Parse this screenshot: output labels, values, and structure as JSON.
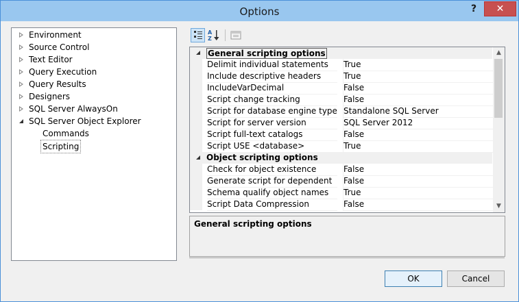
{
  "window": {
    "title": "Options",
    "help_label": "?",
    "close_label": "✕"
  },
  "tree": {
    "items": [
      {
        "label": "Environment",
        "state": "collapsed"
      },
      {
        "label": "Source Control",
        "state": "collapsed"
      },
      {
        "label": "Text Editor",
        "state": "collapsed"
      },
      {
        "label": "Query Execution",
        "state": "collapsed"
      },
      {
        "label": "Query Results",
        "state": "collapsed"
      },
      {
        "label": "Designers",
        "state": "collapsed"
      },
      {
        "label": "SQL Server AlwaysOn",
        "state": "collapsed"
      },
      {
        "label": "SQL Server Object Explorer",
        "state": "expanded"
      },
      {
        "label": "Commands",
        "state": "child"
      },
      {
        "label": "Scripting",
        "state": "child-selected"
      }
    ]
  },
  "toolbar": {
    "categorized_icon": "categorized-icon",
    "alphabetical_icon": "alphabetical-sort-icon",
    "property_pages_icon": "property-pages-icon"
  },
  "grid": {
    "categories": [
      {
        "label": "General scripting options",
        "rows": [
          {
            "name": "Delimit individual statements",
            "value": "True"
          },
          {
            "name": "Include descriptive headers",
            "value": "True"
          },
          {
            "name": "IncludeVarDecimal",
            "value": "False"
          },
          {
            "name": "Script change tracking",
            "value": "False"
          },
          {
            "name": "Script for database engine type",
            "value": "Standalone SQL Server"
          },
          {
            "name": "Script for server version",
            "value": "SQL Server 2012"
          },
          {
            "name": "Script full-text catalogs",
            "value": "False"
          },
          {
            "name": "Script USE <database>",
            "value": "True"
          }
        ]
      },
      {
        "label": "Object scripting options",
        "rows": [
          {
            "name": "Check for object existence",
            "value": "False"
          },
          {
            "name": "Generate script for dependent objects",
            "value": "False"
          },
          {
            "name": "Schema qualify object names",
            "value": "True"
          },
          {
            "name": "Script Data Compression Options",
            "value": "False"
          }
        ]
      }
    ]
  },
  "description": {
    "title": "General scripting options"
  },
  "buttons": {
    "ok": "OK",
    "cancel": "Cancel"
  }
}
